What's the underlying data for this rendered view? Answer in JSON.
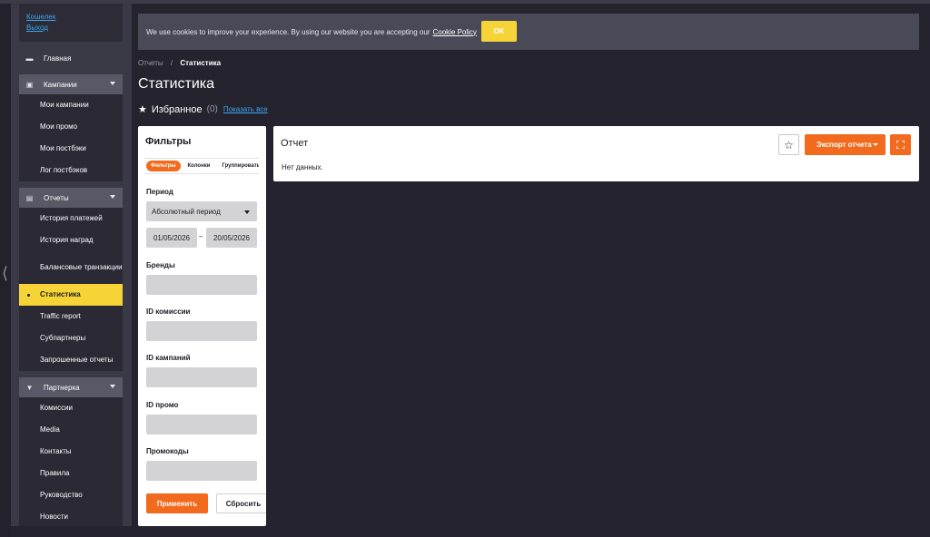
{
  "user_links": {
    "wallet": "Кошелек",
    "logout": "Выход"
  },
  "nav": {
    "home": "Главная",
    "campaigns": {
      "label": "Кампании",
      "items": [
        "Мои кампании",
        "Мои промо",
        "Мои постбэки",
        "Лог постбэков"
      ]
    },
    "reports": {
      "label": "Отчеты",
      "items": [
        "История платежей",
        "История наград",
        "Балансовые транзакции",
        "Статистика",
        "Traffic report",
        "Субпартнеры",
        "Запрошенные отчеты"
      ]
    },
    "partner": {
      "label": "Партнерка",
      "items": [
        "Комиссии",
        "Media",
        "Контакты",
        "Правила",
        "Руководство",
        "Новости"
      ]
    }
  },
  "cookie": {
    "text": "We use cookies to improve your experience. By using our website you are accepting our",
    "link": "Cookie Policy",
    "ok": "OK"
  },
  "breadcrumb": {
    "parent": "Отчеты",
    "sep": "/",
    "current": "Статистика"
  },
  "page_title": "Статистика",
  "favorites": {
    "label": "Избранное",
    "count": "(0)",
    "show_all": "Показать все"
  },
  "filters": {
    "title": "Фильтры",
    "tabs": [
      "Фильтры",
      "Колонки",
      "Группировать"
    ],
    "period_label": "Период",
    "period_value": "Абсолютный период",
    "date_from": "01/05/2026",
    "date_sep": "–",
    "date_to": "20/05/2026",
    "brands": "Бренды",
    "commission_id": "ID комиссии",
    "campaign_id": "ID кампаний",
    "promo_id": "ID промо",
    "promocodes": "Промокоды",
    "apply": "Применить",
    "reset": "Сбросить"
  },
  "report": {
    "title": "Отчет",
    "empty": "Нет данных.",
    "export": "Экспорт отчета"
  },
  "colors": {
    "accent": "#f26a1d",
    "highlight": "#f6d437",
    "link": "#3ba5f0",
    "bg": "#24232e"
  },
  "icons": {
    "home": "home-icon",
    "campaigns": "briefcase-icon",
    "reports": "clipboard-icon",
    "partner": "funnel-icon",
    "star": "star-icon",
    "fullscreen": "fullscreen-icon"
  }
}
